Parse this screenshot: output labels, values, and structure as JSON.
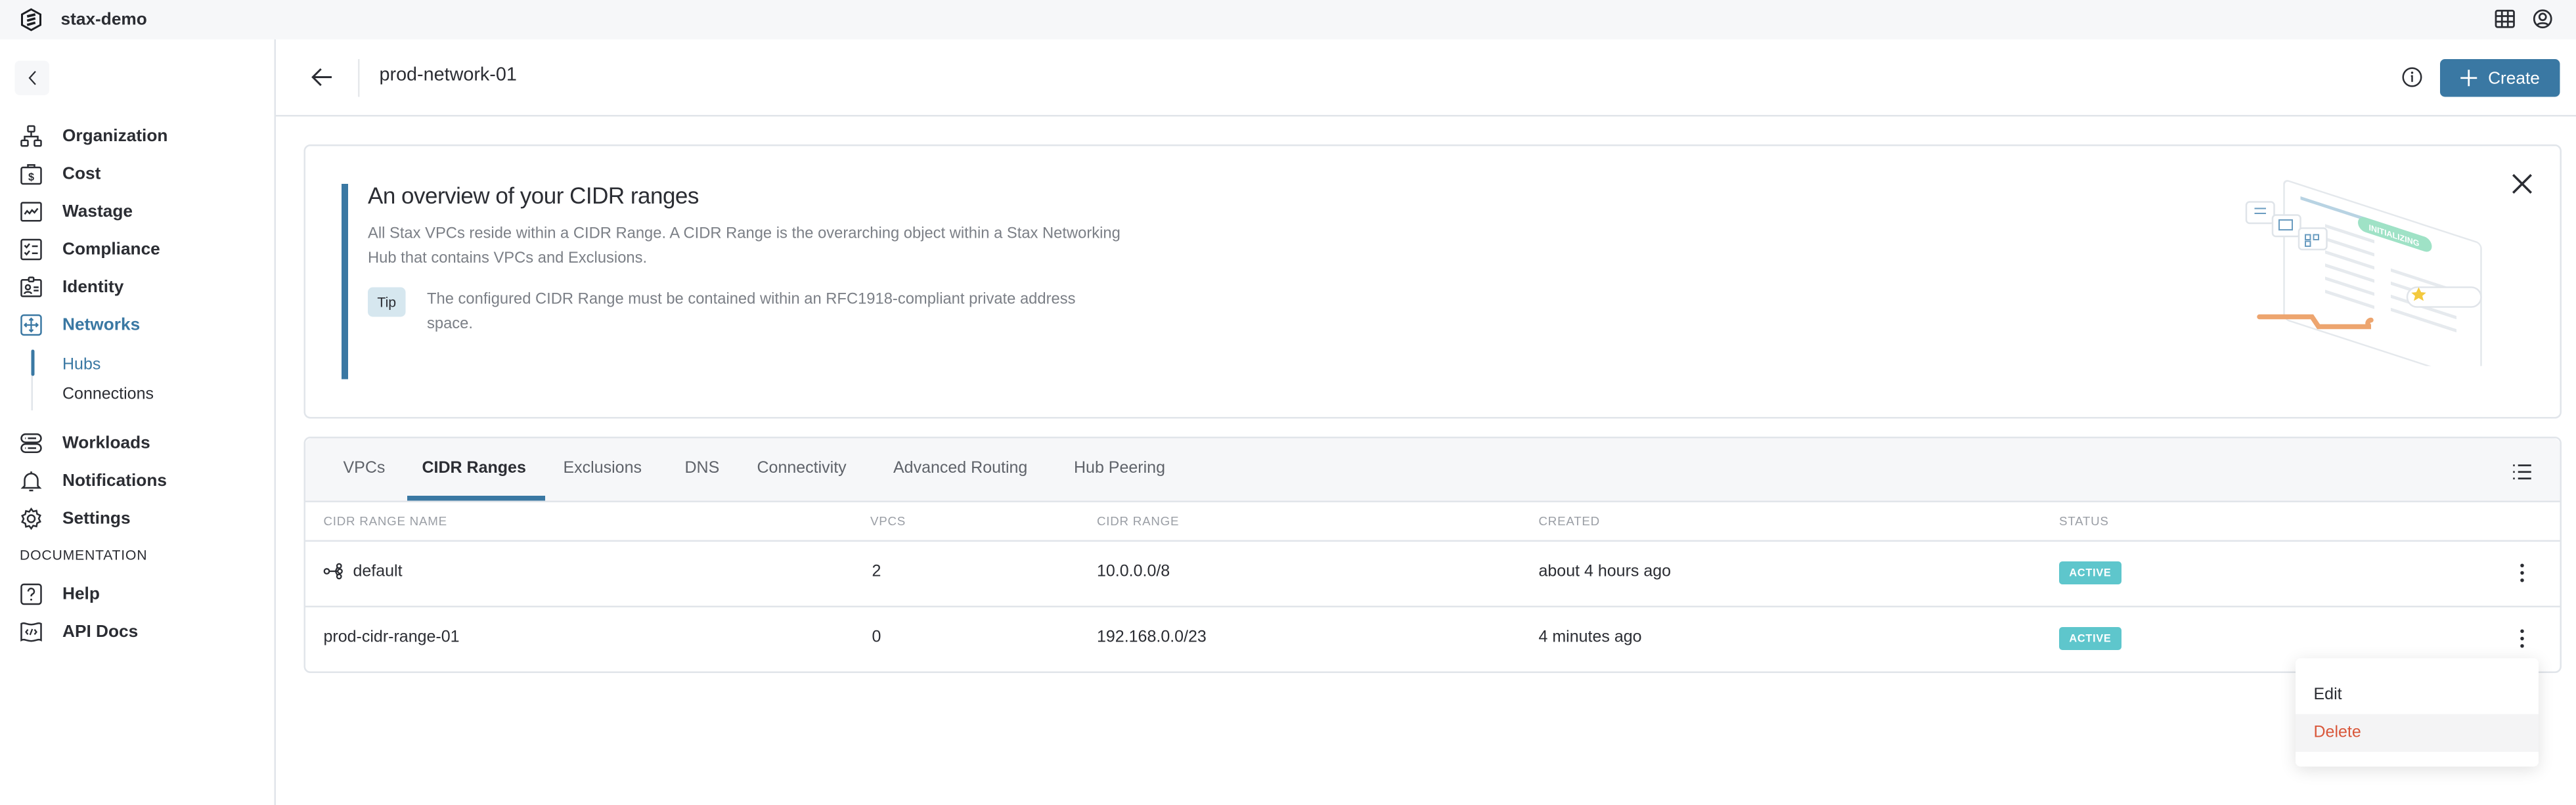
{
  "topbar": {
    "org_name": "stax-demo",
    "icons": [
      "stax-logo-icon",
      "apps-grid-icon",
      "user-account-icon"
    ]
  },
  "sidebar": {
    "collapse_icon": "chevron-left-icon",
    "items": [
      {
        "label": "Organization",
        "icon": "org-chart-icon"
      },
      {
        "label": "Cost",
        "icon": "dollar-bag-icon"
      },
      {
        "label": "Wastage",
        "icon": "line-graph-icon"
      },
      {
        "label": "Compliance",
        "icon": "checklist-icon"
      },
      {
        "label": "Identity",
        "icon": "id-badge-icon"
      },
      {
        "label": "Networks",
        "icon": "network-arrows-icon",
        "active": true
      }
    ],
    "sub_items": [
      {
        "label": "Hubs",
        "active": true
      },
      {
        "label": "Connections"
      }
    ],
    "items_after": [
      {
        "label": "Workloads",
        "icon": "servers-icon"
      },
      {
        "label": "Notifications",
        "icon": "bell-icon"
      },
      {
        "label": "Settings",
        "icon": "gear-icon"
      }
    ],
    "doc_heading": "DOCUMENTATION",
    "doc_items": [
      {
        "label": "Help",
        "icon": "question-icon"
      },
      {
        "label": "API Docs",
        "icon": "code-flag-icon"
      }
    ]
  },
  "header": {
    "title": "prod-network-01",
    "create_label": "Create"
  },
  "overview": {
    "title": "An overview of your CIDR ranges",
    "description": "All Stax VPCs reside within a CIDR Range. A CIDR Range is the overarching object within a Stax Networking Hub that contains VPCs and Exclusions.",
    "tip_label": "Tip",
    "tip_text": "The configured CIDR Range must be contained within an RFC1918-compliant private address space.",
    "illustration_badge": "INITIALIZING"
  },
  "tabs": [
    {
      "label": "VPCs"
    },
    {
      "label": "CIDR Ranges",
      "active": true
    },
    {
      "label": "Exclusions"
    },
    {
      "label": "DNS"
    },
    {
      "label": "Connectivity"
    },
    {
      "label": "Advanced Routing"
    },
    {
      "label": "Hub Peering"
    }
  ],
  "table": {
    "columns": [
      "CIDR RANGE NAME",
      "VPCS",
      "CIDR RANGE",
      "CREATED",
      "STATUS"
    ],
    "rows": [
      {
        "name": "default",
        "is_default": true,
        "vpcs": "2",
        "cidr": "10.0.0.0/8",
        "created": "about 4 hours ago",
        "status": "ACTIVE"
      },
      {
        "name": "prod-cidr-range-01",
        "vpcs": "0",
        "cidr": "192.168.0.0/23",
        "created": "4 minutes ago",
        "status": "ACTIVE"
      }
    ]
  },
  "row_menu": {
    "items": [
      "Edit",
      "Delete"
    ]
  },
  "colors": {
    "accent": "#3a78a3",
    "status_active": "#5ec6cc",
    "danger": "#d9573a"
  }
}
